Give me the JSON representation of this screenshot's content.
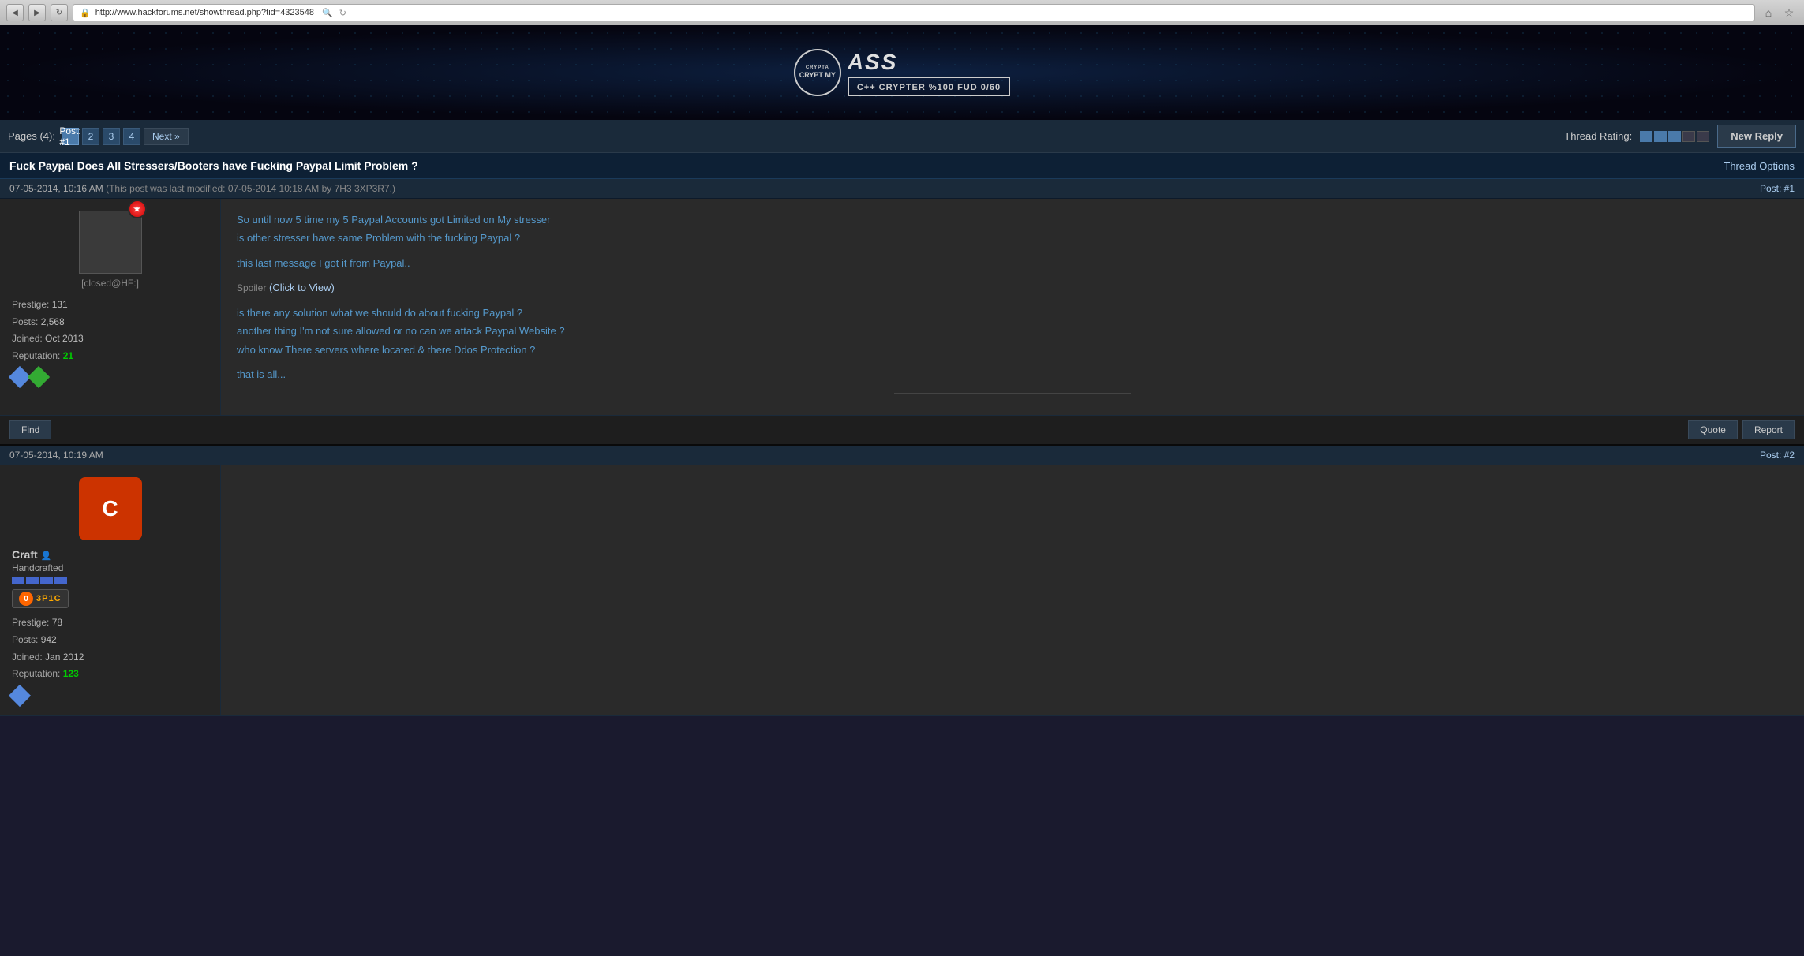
{
  "browser": {
    "url": "http://www.hackforums.net/showthread.php?tid=4323548",
    "back_btn": "◀",
    "forward_btn": "▶",
    "refresh_btn": "↻",
    "search_icon": "🔍",
    "home_icon": "⌂",
    "star_icon": "☆"
  },
  "banner": {
    "logo_text": "CRYPTA\nCRYPT MY\nASS",
    "subtitle": "C++ CRYPTER  %100 FUD 0/60"
  },
  "pagination": {
    "label": "Pages (4):",
    "pages": [
      "1",
      "2",
      "3",
      "4"
    ],
    "active_page": "1",
    "next_label": "Next »"
  },
  "thread_rating": {
    "label": "Thread Rating:",
    "filled_stars": 3,
    "empty_stars": 2
  },
  "new_reply_btn": "New Reply",
  "thread": {
    "title": "Fuck Paypal Does All Stressers/Booters have Fucking Paypal Limit Problem ?",
    "options_label": "Thread Options"
  },
  "posts": [
    {
      "date": "07-05-2014, 10:16 AM",
      "modified_text": "(This post was last modified: 07-05-2014 10:18 AM by 7H3 3XP3R7.)",
      "post_num": "Post: #1",
      "username": "[closed@HF:]",
      "prestige": "131",
      "posts": "2,568",
      "joined": "Oct 2013",
      "reputation": "21",
      "rep_color": "positive",
      "content_lines": [
        "So until now 5 time my 5 Paypal Accounts got Limited on My stresser",
        "is other stresser have same Problem with the fucking Paypal ?",
        "",
        "this last message I got it from Paypal..",
        "",
        "is there any solution what we should do about fucking Paypal ?",
        "another thing I'm not sure allowed or no can we attack Paypal Website ?",
        "who know There servers where located & there Ddos Protection ?",
        "",
        "that is all..."
      ],
      "spoiler_text": "Spoiler",
      "spoiler_link": "(Click to View)",
      "find_btn": "Find",
      "quote_btn": "Quote",
      "report_btn": "Report"
    },
    {
      "date": "07-05-2014, 10:19 AM",
      "post_num": "Post: #2",
      "username": "Craft",
      "rank_title": "Handcrafted",
      "prestige": "78",
      "posts": "942",
      "joined": "Jan 2012",
      "reputation": "123",
      "rep_color": "positive",
      "avatar_letter": "C",
      "epic_num": "0",
      "epic_label": "3P1C",
      "rank_bars": 4
    }
  ]
}
